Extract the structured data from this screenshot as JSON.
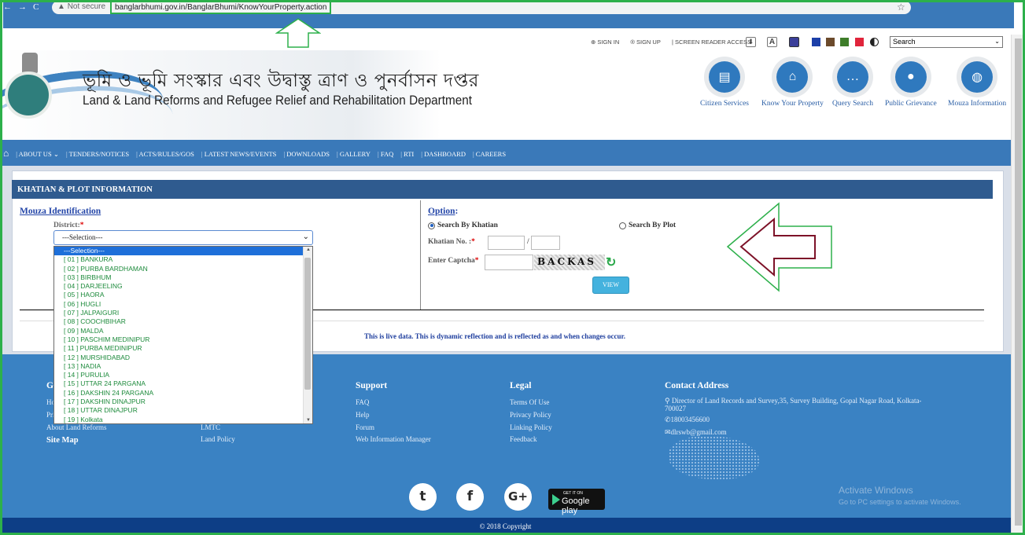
{
  "browser": {
    "security": "Not secure",
    "url": "banglarbhumi.gov.in/BanglarBhumi/KnowYourProperty.action"
  },
  "topbar": {
    "sign_in": "SIGN IN",
    "sign_up": "SIGN UP",
    "screen_reader": "SCREEN READER ACCESS",
    "search_select": "Search",
    "swatch_colors": [
      "#1c3fa8",
      "#6b4a2b",
      "#3e7d2a",
      "#e0243b"
    ]
  },
  "header": {
    "title_bn": "ভূমি ও ভূমি সংস্কার এবং উদ্বাস্তু ত্রাণ ও পুনর্বাসন দপ্তর",
    "title_en": "Land & Land Reforms and Refugee Relief and Rehabilitation Department",
    "services": [
      {
        "label": "Citizen Services",
        "icon": "id-card-icon"
      },
      {
        "label": "Know Your Property",
        "icon": "home-icon"
      },
      {
        "label": "Query Search",
        "icon": "chat-icon"
      },
      {
        "label": "Public Grievance",
        "icon": "group-icon"
      },
      {
        "label": "Mouza Information",
        "icon": "globe-icon"
      }
    ]
  },
  "nav": {
    "items": [
      "ABOUT US",
      "TENDERS/NOTICES",
      "ACTS/RULES/GOS",
      "LATEST NEWS/EVENTS",
      "DOWNLOADS",
      "GALLERY",
      "FAQ",
      "RTI",
      "DASHBOARD",
      "CAREERS"
    ]
  },
  "panel": {
    "title": "KHATIAN & PLOT INFORMATION",
    "mouza_heading": "Mouza Identification",
    "district_label": "District:",
    "district_selected": "---Selection---",
    "district_options": [
      "---Selection---",
      "[ 01 ] BANKURA",
      "[ 02 ] PURBA BARDHAMAN",
      "[ 03 ] BIRBHUM",
      "[ 04 ] DARJEELING",
      "[ 05 ] HAORA",
      "[ 06 ] HUGLI",
      "[ 07 ] JALPAIGURI",
      "[ 08 ] COOCHBIHAR",
      "[ 09 ] MALDA",
      "[ 10 ] PASCHIM MEDINIPUR",
      "[ 11 ] PURBA MEDINIPUR",
      "[ 12 ] MURSHIDABAD",
      "[ 13 ] NADIA",
      "[ 14 ] PURULIA",
      "[ 15 ] UTTAR 24 PARGANA",
      "[ 16 ] DAKSHIN 24 PARGANA",
      "[ 17 ] DAKSHIN DINAJPUR",
      "[ 18 ] UTTAR DINAJPUR",
      "[ 19 ] Kolkata"
    ],
    "option_heading": "Option",
    "radio_khatian": "Search By Khatian",
    "radio_plot": "Search By Plot",
    "khatian_label": "Khatian No. :",
    "khatian_sep": "/",
    "captcha_label": "Enter Captcha",
    "captcha_text": "BACKAS",
    "view_button": "VIEW",
    "live_note": "This is live data. This is dynamic reflection and is reflected as and when changes occur."
  },
  "footer": {
    "col1_heading": "G",
    "col1_links": [
      "Ho",
      "Pri",
      "About Land Reforms"
    ],
    "site_map": "Site Map",
    "col2_links": [
      "LMTC",
      "Land Policy"
    ],
    "support_heading": "Support",
    "support_links": [
      "FAQ",
      "Help",
      "Forum",
      "Web Information Manager"
    ],
    "legal_heading": "Legal",
    "legal_links": [
      "Terms Of Use",
      "Privacy Policy",
      "Linking Policy",
      "Feedback"
    ],
    "contact_heading": "Contact Address",
    "address": "Director of Land Records and Survey,35, Survey Building, Gopal Nagar Road, Kolkata-700027",
    "phone": "18003456600",
    "email": "dlrswb@gmail.com",
    "gplay_small": "GET IT ON",
    "gplay_big": "Google play",
    "activate_title": "Activate Windows",
    "activate_sub": "Go to PC settings to activate Windows.",
    "copyright": "© 2018 Copyright"
  }
}
